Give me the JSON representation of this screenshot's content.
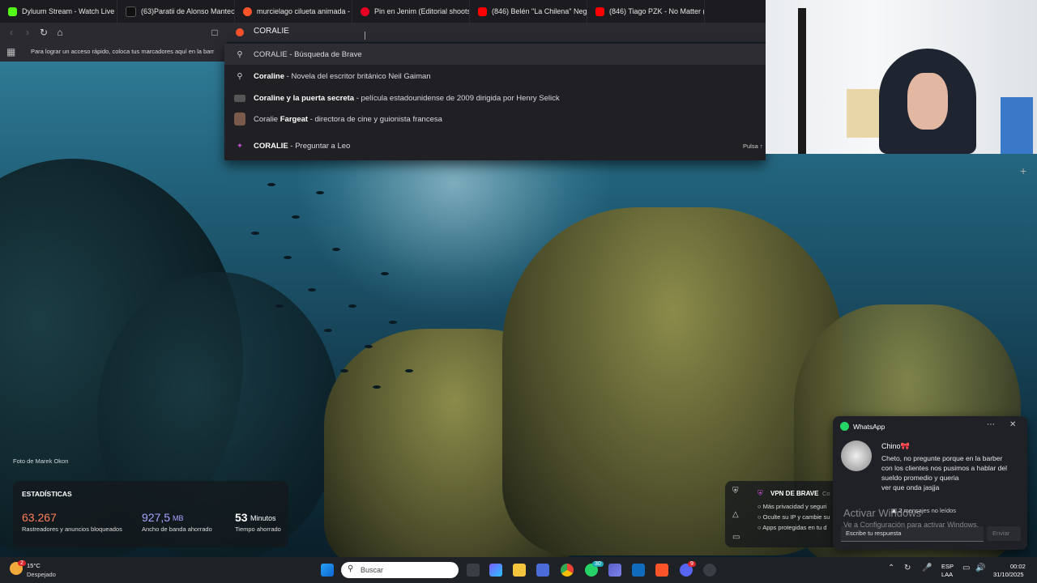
{
  "tabs": [
    {
      "title": "Dyluum Stream - Watch Live on Kick",
      "icon_color": "#53fc18",
      "icon": "kick-icon"
    },
    {
      "title": "(63)Paratii de Alonso Manteca: Unis",
      "icon_color": "#111111",
      "icon": "tiktok-icon"
    },
    {
      "title": "murcielago cilueta animada - Brave S",
      "icon_color": "#fb542b",
      "icon": "brave-search-icon"
    },
    {
      "title": "Pin en Jenim (Editorial shoots)",
      "icon_color": "#e60023",
      "icon": "pinterest-icon"
    },
    {
      "title": "(846) Belén \"La Chilena\" Negri confi",
      "icon_color": "#ff0000",
      "icon": "youtube-icon"
    },
    {
      "title": "(846) Tiago PZK - No Matter (",
      "icon_color": "#ff0000",
      "icon": "youtube-icon"
    }
  ],
  "url": {
    "value": "CORALIE"
  },
  "bookmarks": {
    "hint": "Para lograr un acceso rápido, coloca tus marcadores aquí en la barr"
  },
  "suggestions": [
    {
      "bold": "CORALIE",
      "rest": " - Búsqueda de Brave",
      "icon": "search-icon"
    },
    {
      "bold": "Coraline",
      "rest": " - Novela del escritor británico Neil Gaiman",
      "icon": "search-icon"
    },
    {
      "bold": "Coraline y la puerta secreta",
      "rest": " - película estadounidense de 2009 dirigida por Henry Selick",
      "icon": "movie-thumbnail-icon"
    },
    {
      "pre": "Coralie ",
      "bold": "Fargeat",
      "rest": " - directora de cine y guionista francesa",
      "icon": "person-avatar-icon"
    },
    {
      "bold": "CORALIE",
      "rest": " - Preguntar a Leo",
      "icon": "leo-ai-icon",
      "hint": "Pulsa ↑"
    }
  ],
  "photo_credit": "Foto de Marek Okon",
  "stats": {
    "title": "ESTADÍSTICAS",
    "trackers_value": "63.267",
    "trackers_label": "Rastreadores y anuncios bloqueados",
    "bandwidth_value": "927,5",
    "bandwidth_unit": "MB",
    "bandwidth_label": "Ancho de banda ahorrado",
    "time_value": "53",
    "time_unit": "Minutos",
    "time_label": "Tiempo ahorrado",
    "colors": {
      "trackers": "#ff7f5a",
      "bandwidth": "#a8a4ff",
      "time": "#ffffff"
    }
  },
  "vpn": {
    "title": "VPN DE BRAVE",
    "extra": "Co",
    "items": [
      "Más privacidad y seguri",
      "Oculte su IP y cambie su",
      "Apps protegidas en tu d"
    ]
  },
  "whatsapp": {
    "app": "WhatsApp",
    "sender": "Chino🎀",
    "message": [
      "Cheto, no pregunte porque en la barber",
      "con los clientes nos pusimos a hablar del",
      "sueldo promedio y queria",
      "ver que onda jasjja"
    ],
    "unread": "2 mensajes no leídos",
    "reply_placeholder": "Escribe tu respuesta",
    "send": "Enviar"
  },
  "activate": {
    "title": "Activar Windows",
    "subtitle": "Ve a Configuración para activar Windows."
  },
  "taskbar": {
    "weather_temp": "15°C",
    "weather_desc": "Despejado",
    "weather_badge": "2",
    "search_placeholder": "Buscar",
    "lang": "ESP",
    "lang_sub": "LAA",
    "time": "00:02",
    "date": "31/10/2025",
    "whatsapp_badge": "30",
    "discord_badge": "9"
  }
}
